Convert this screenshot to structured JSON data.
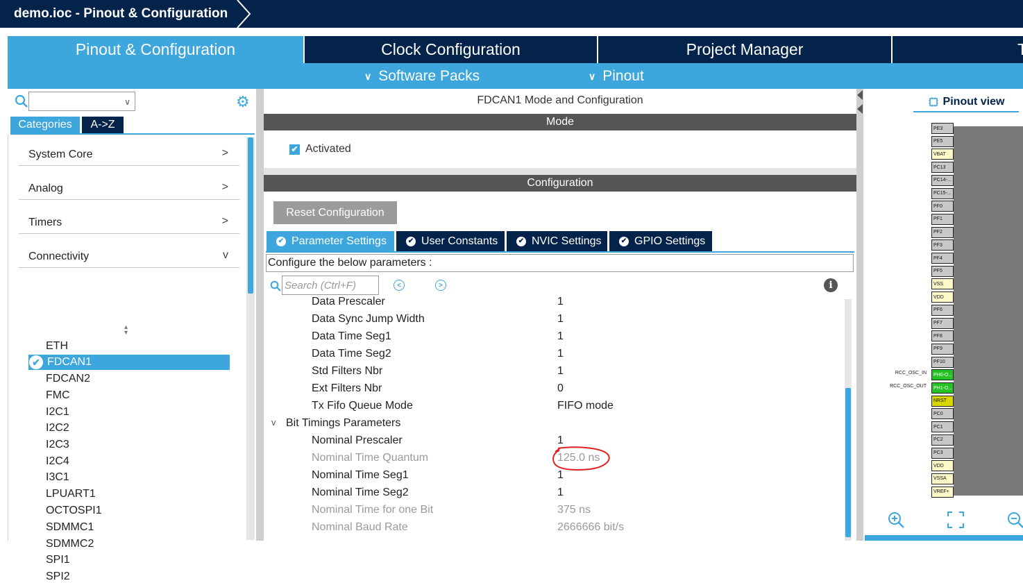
{
  "window": {
    "title": "demo.ioc - Pinout & Configuration"
  },
  "tabs": [
    {
      "label": "Pinout & Configuration",
      "active": true
    },
    {
      "label": "Clock Configuration",
      "active": false
    },
    {
      "label": "Project Manager",
      "active": false
    },
    {
      "label": "T",
      "active": false
    }
  ],
  "subbar": {
    "software_packs": "Software Packs",
    "pinout": "Pinout"
  },
  "left": {
    "search_value": "",
    "segments": {
      "categories": "Categories",
      "az": "A->Z"
    },
    "categories": [
      {
        "label": "System Core",
        "chevron": ">"
      },
      {
        "label": "Analog",
        "chevron": ">"
      },
      {
        "label": "Timers",
        "chevron": ">"
      },
      {
        "label": "Connectivity",
        "chevron": "v"
      }
    ],
    "connectivity_items": [
      "ETH",
      "FDCAN1",
      "FDCAN2",
      "FMC",
      "I2C1",
      "I2C2",
      "I2C3",
      "I2C4",
      "I3C1",
      "LPUART1",
      "OCTOSPI1",
      "SDMMC1",
      "SDMMC2",
      "SPI1",
      "SPI2"
    ],
    "selected_item": "FDCAN1"
  },
  "mid": {
    "header": "FDCAN1 Mode and Configuration",
    "mode_bar": "Mode",
    "activated_label": "Activated",
    "config_bar": "Configuration",
    "reset_button": "Reset Configuration",
    "param_tabs": [
      "Parameter Settings",
      "User Constants",
      "NVIC Settings",
      "GPIO Settings"
    ],
    "configure_text": "Configure the below parameters :",
    "search_placeholder": "Search (Ctrl+F)",
    "params": [
      {
        "name": "Data Prescaler",
        "value": "1",
        "readonly": false
      },
      {
        "name": "Data Sync Jump Width",
        "value": "1",
        "readonly": false
      },
      {
        "name": "Data Time Seg1",
        "value": "1",
        "readonly": false
      },
      {
        "name": "Data Time Seg2",
        "value": "1",
        "readonly": false
      },
      {
        "name": "Std Filters Nbr",
        "value": "1",
        "readonly": false
      },
      {
        "name": "Ext Filters Nbr",
        "value": "0",
        "readonly": false
      },
      {
        "name": "Tx Fifo Queue Mode",
        "value": "FIFO mode",
        "readonly": false
      }
    ],
    "group": {
      "name": "Bit Timings Parameters",
      "toggle": "v"
    },
    "bit_params": [
      {
        "name": "Nominal Prescaler",
        "value": "1",
        "readonly": false
      },
      {
        "name": "Nominal Time Quantum",
        "value": "125.0 ns",
        "readonly": true
      },
      {
        "name": "Nominal Time Seg1",
        "value": "1",
        "readonly": false
      },
      {
        "name": "Nominal Time Seg2",
        "value": "1",
        "readonly": false
      },
      {
        "name": "Nominal Time for one Bit",
        "value": "375 ns",
        "readonly": true
      },
      {
        "name": "Nominal Baud Rate",
        "value": "2666666 bit/s",
        "readonly": true
      }
    ]
  },
  "right": {
    "pinout_view_label": "Pinout view",
    "pins": [
      {
        "name": "PE3",
        "kind": "io"
      },
      {
        "name": "PE5",
        "kind": "io"
      },
      {
        "name": "VBAT",
        "kind": "power"
      },
      {
        "name": "PC13",
        "kind": "io"
      },
      {
        "name": "PC14-...",
        "kind": "io"
      },
      {
        "name": "PC15-...",
        "kind": "io"
      },
      {
        "name": "PF0",
        "kind": "io"
      },
      {
        "name": "PF1",
        "kind": "io"
      },
      {
        "name": "PF2",
        "kind": "io"
      },
      {
        "name": "PF3",
        "kind": "io"
      },
      {
        "name": "PF4",
        "kind": "io"
      },
      {
        "name": "PF5",
        "kind": "io"
      },
      {
        "name": "VSS",
        "kind": "power"
      },
      {
        "name": "VDD",
        "kind": "power"
      },
      {
        "name": "PF6",
        "kind": "io"
      },
      {
        "name": "PF7",
        "kind": "io"
      },
      {
        "name": "PF8",
        "kind": "io"
      },
      {
        "name": "PF9",
        "kind": "io"
      },
      {
        "name": "PF10",
        "kind": "io"
      },
      {
        "name": "PH0-O...",
        "kind": "assigned"
      },
      {
        "name": "PH1-O...",
        "kind": "assigned"
      },
      {
        "name": "NRST",
        "kind": "reset"
      },
      {
        "name": "PC0",
        "kind": "io"
      },
      {
        "name": "PC1",
        "kind": "io"
      },
      {
        "name": "PC2",
        "kind": "io"
      },
      {
        "name": "PC3",
        "kind": "io"
      },
      {
        "name": "VDD",
        "kind": "power"
      },
      {
        "name": "VSSA",
        "kind": "power"
      },
      {
        "name": "VREF+",
        "kind": "power"
      }
    ],
    "pin_labels": {
      "osc_in": "RCC_OSC_IN",
      "osc_out": "RCC_OSC_OUT"
    }
  },
  "colors": {
    "accent": "#3ca6dd",
    "navy": "#03234b",
    "bar_gray": "#555555",
    "assigned_pin": "#22c322",
    "annotation": "#e02020"
  }
}
